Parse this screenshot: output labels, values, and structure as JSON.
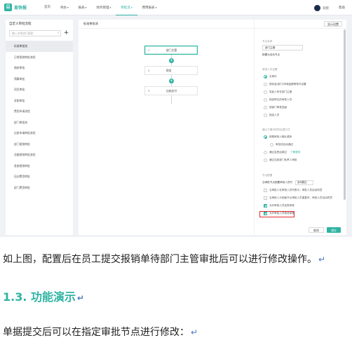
{
  "app": {
    "brand": "易快报",
    "brand_glyph": "易",
    "nav": [
      {
        "label": "首页",
        "dropdown": false,
        "active": false
      },
      {
        "label": "待办",
        "dropdown": true,
        "active": false
      },
      {
        "label": "报表",
        "dropdown": true,
        "active": false
      },
      {
        "label": "财务管理",
        "dropdown": true,
        "active": false
      },
      {
        "label": "审批流",
        "dropdown": true,
        "active": true
      },
      {
        "label": "费用报表",
        "dropdown": true,
        "active": false
      }
    ],
    "user_name": "刘欣",
    "help_label": "帮助",
    "accent_color": "#2fb3a3"
  },
  "left_panel": {
    "title": "自定义审批流程",
    "search_placeholder": "输入名称进行搜索",
    "add_glyph": "+",
    "items": [
      "标准审批流",
      "日常报销审批流程",
      "借款审批",
      "预算审批",
      "项目审批",
      "采购审批",
      "费用申请流程",
      "部门审批流",
      "出差申请审批流程",
      "部门报销审批",
      "总额报销审批流程",
      "差旅报销审批",
      "培训费用审批",
      "部门费用审批"
    ],
    "selected_index": 0
  },
  "canvas": {
    "title": "标准审批流",
    "nodes": [
      {
        "num": "1",
        "label": "部门主管",
        "active": true
      },
      {
        "num": "2",
        "label": "财务",
        "active": false
      },
      {
        "num": "3",
        "label": "出纳支付",
        "active": false
      }
    ],
    "plus_glyph": "+"
  },
  "settings": {
    "top_button": "显示设置",
    "node_name_label": "节点名称",
    "node_name_value": "部门主管",
    "node_name_sub": "配置为自动节点",
    "approver_section": "审批人员设置",
    "approver_options": [
      {
        "label": "无条件",
        "checked": true
      },
      {
        "label": "按标准/部门/申请金额等条件设置",
        "checked": false
      },
      {
        "label": "发起人所在部门主管",
        "checked": false
      },
      {
        "label": "指定职位的审批人员",
        "checked": false
      },
      {
        "label": "按部门审批层级",
        "checked": false
      },
      {
        "label": "指定人员",
        "checked": false
      }
    ],
    "multi_section": "遇以下情况时的处理方式",
    "multi_options": [
      {
        "label": "按照审批人确认顺序",
        "checked": true,
        "indent": false,
        "link": ""
      },
      {
        "label": "审批流自动通过",
        "checked": false,
        "indent": true,
        "link": ""
      },
      {
        "label": "通过会签后跳过",
        "checked": false,
        "indent": false,
        "link": "了解更多"
      },
      {
        "label": "通过当前部门负责人审批",
        "checked": false,
        "indent": false,
        "link": ""
      }
    ],
    "node_config_section": "节点配置",
    "node_config_line": "当审批节点配置审批人员时",
    "node_config_select": "自动跳过",
    "checks": [
      {
        "label": "当审批人在审批人员列表中，审批人员自动同意",
        "checked": false
      },
      {
        "label": "当审批人与前面节点审批人员重复时，审批人员自动同意",
        "checked": false
      },
      {
        "label": "允许审批人员加签审批",
        "checked": true
      },
      {
        "label": "允许审批人员修改单据",
        "checked": true
      }
    ],
    "cancel_label": "取消",
    "save_label": "保存"
  },
  "doc": {
    "caption": "如上图，配置后在员工提交报销单待部门主管审批后可以进行修改操作。",
    "heading": "1.3. 功能演示",
    "paragraph": "单据提交后可以在指定审批节点进行修改：",
    "return_mark": "↵"
  }
}
